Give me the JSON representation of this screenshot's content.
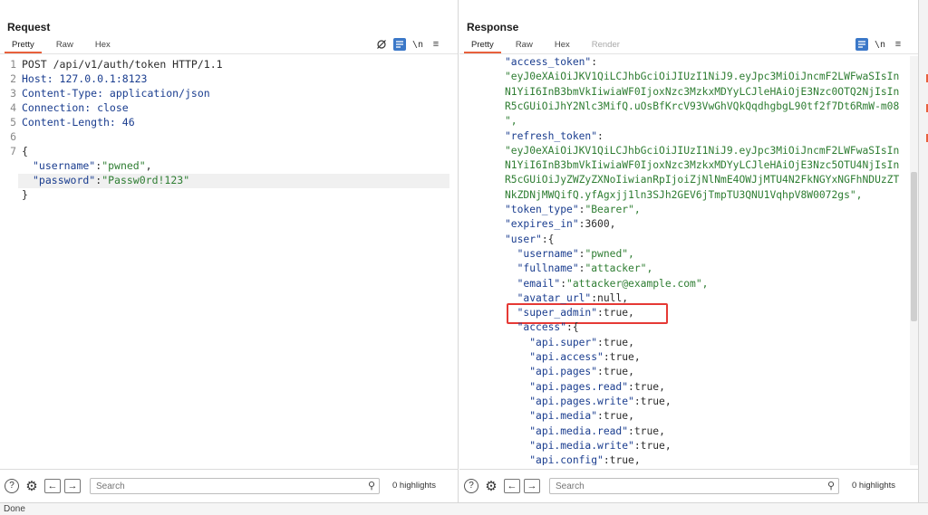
{
  "request": {
    "title": "Request",
    "tabs": [
      "Pretty",
      "Raw",
      "Hex"
    ],
    "active_tab": "Pretty",
    "line_numbers": [
      "1",
      "2",
      "3",
      "4",
      "5",
      "6",
      "7"
    ],
    "lines": {
      "l1": "POST /api/v1/auth/token HTTP/1.1",
      "l2": "Host: 127.0.0.1:8123",
      "l3": "Content-Type: application/json",
      "l4": "Connection: close",
      "l5": "Content-Length: 46",
      "l7": "{",
      "l8_key": "\"username\"",
      "l8_val": "\"pwned\"",
      "l9_key": "\"password\"",
      "l9_val": "\"Passw0rd!123\"",
      "l10": "}"
    },
    "footer": {
      "search_placeholder": "Search",
      "highlights": "0 highlights"
    }
  },
  "response": {
    "title": "Response",
    "tabs": [
      "Pretty",
      "Raw",
      "Hex",
      "Render"
    ],
    "active_tab": "Pretty",
    "lines": [
      "\"access_token\":",
      "\"eyJ0eXAiOiJKV1QiLCJhbGciOiJIUzI1NiJ9.eyJpc3MiOiJncmF2LWFwaSIsIn",
      "N1YiI6InB3bmVkIiwiaWF0IjoxNzc3MzkxMDYyLCJleHAiOjE3Nzc0OTQ2NjIsIn",
      "R5cGUiOiJhY2Nlc3MifQ.uOsBfKrcV93VwGhVQkQqdhgbgL90tf2f7Dt6RmW-m08",
      "\",",
      "\"refresh_token\":",
      "\"eyJ0eXAiOiJKV1QiLCJhbGciOiJIUzI1NiJ9.eyJpc3MiOiJncmF2LWFwaSIsIn",
      "N1YiI6InB3bmVkIiwiaWF0IjoxNzc3MzkxMDYyLCJleHAiOjE3Nzc5OTU4NjIsIn",
      "R5cGUiOiJyZWZyZXNoIiwianRpIjoiZjNlNmE4OWJjMTU4N2FkNGYxNGFhNDUzZT",
      "NkZDNjMWQifQ.yfAgxjj1ln3SJh2GEV6jTmpTU3QNU1VqhpV8W0072gs\",",
      "\"token_type\":\"Bearer\",",
      "\"expires_in\":3600,",
      "\"user\":{",
      "  \"username\":\"pwned\",",
      "  \"fullname\":\"attacker\",",
      "  \"email\":\"attacker@example.com\",",
      "  \"avatar_url\":null,",
      "  \"super_admin\":true,",
      "  \"access\":{",
      "    \"api.super\":true,",
      "    \"api.access\":true,",
      "    \"api.pages\":true,",
      "    \"api.pages.read\":true,",
      "    \"api.pages.write\":true,",
      "    \"api.media\":true,",
      "    \"api.media.read\":true,",
      "    \"api.media.write\":true,",
      "    \"api.config\":true,"
    ],
    "footer": {
      "search_placeholder": "Search",
      "highlights": "0 highlights"
    }
  },
  "status": "Done",
  "colors": {
    "accent": "#e8603c",
    "string": "#2e7d32",
    "key": "#1a3d8f",
    "highlight_box": "#e53935",
    "toggle_active": "#3b78c8"
  }
}
